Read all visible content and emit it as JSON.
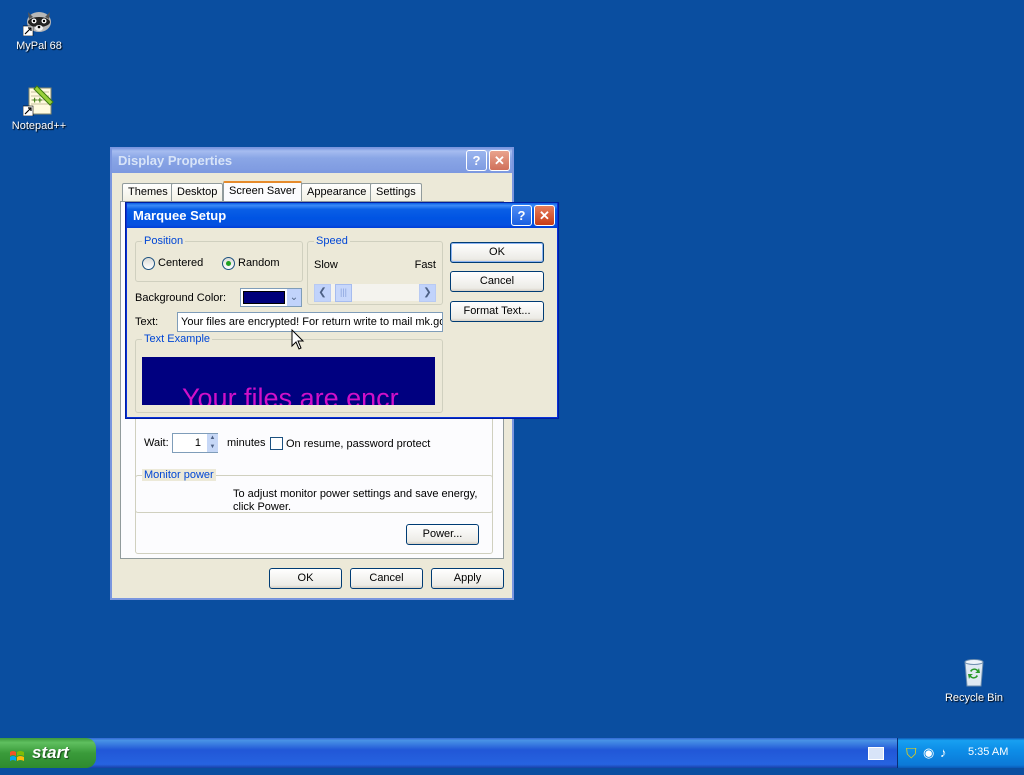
{
  "desktop": {
    "icons": [
      {
        "label": "MyPal 68"
      },
      {
        "label": "Notepad++"
      },
      {
        "label": "Recycle Bin"
      }
    ]
  },
  "display_properties": {
    "title": "Display Properties",
    "tabs": [
      "Themes",
      "Desktop",
      "Screen Saver",
      "Appearance",
      "Settings"
    ],
    "active_tab": "Screen Saver",
    "wait_label": "Wait:",
    "wait_value": "1",
    "minutes_label": "minutes",
    "password_label": "On resume, password protect",
    "monitor_power": {
      "group_label": "Monitor power",
      "description": "To adjust monitor power settings and save energy, click Power.",
      "power_button": "Power..."
    },
    "buttons": {
      "ok": "OK",
      "cancel": "Cancel",
      "apply": "Apply"
    }
  },
  "marquee_setup": {
    "title": "Marquee Setup",
    "position": {
      "group_label": "Position",
      "options": [
        "Centered",
        "Random"
      ],
      "selected": "Random"
    },
    "speed": {
      "group_label": "Speed",
      "slow_label": "Slow",
      "fast_label": "Fast",
      "value_fraction": 0.08
    },
    "background_color": {
      "label": "Background Color:",
      "value_hex": "#00007a"
    },
    "text": {
      "label": "Text:",
      "value": "Your files are encrypted! For return write to mail mk.gorc"
    },
    "text_example": {
      "group_label": "Text Example",
      "preview": "Your files are encr",
      "text_color": "#d010c8",
      "bg_color": "#000080"
    },
    "buttons": {
      "ok": "OK",
      "cancel": "Cancel",
      "format_text": "Format Text..."
    }
  },
  "taskbar": {
    "start_label": "start",
    "clock": "5:35 AM"
  },
  "colors": {
    "desktop": "#0a4ea0",
    "accent": "#0054e3"
  }
}
